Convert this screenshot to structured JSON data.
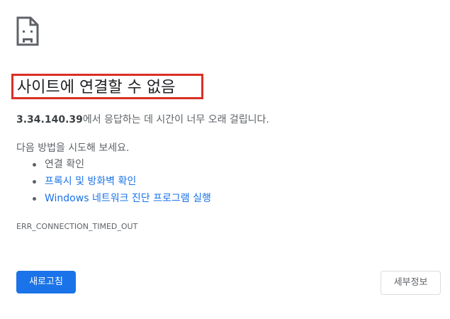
{
  "error_page": {
    "icon": "sad-page-icon",
    "title": "사이트에 연결할 수 없음",
    "summary_host": "3.34.140.39",
    "summary_text": "에서 응답하는 데 시간이 너무 오래 걸립니다.",
    "suggestions_heading": "다음 방법을 시도해 보세요.",
    "suggestions": [
      {
        "label": "연결 확인",
        "is_link": false
      },
      {
        "label": "프록시 및 방화벽 확인",
        "is_link": true
      },
      {
        "label": "Windows 네트워크 진단 프로그램 실행",
        "is_link": true
      }
    ],
    "error_code": "ERR_CONNECTION_TIMED_OUT",
    "reload_label": "새로고침",
    "details_label": "세부정보"
  },
  "colors": {
    "title_highlight_border": "#d93025",
    "link": "#1a73e8",
    "primary_button": "#1a73e8",
    "secondary_text": "#5f6368"
  }
}
